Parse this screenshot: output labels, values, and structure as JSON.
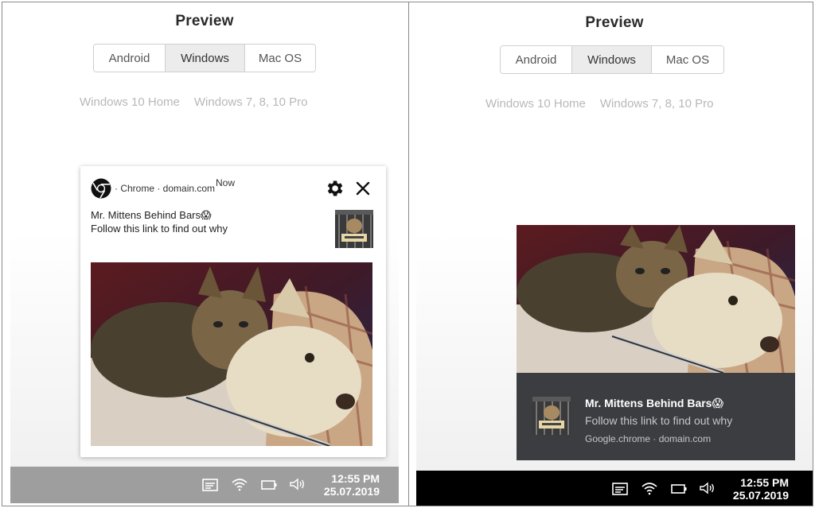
{
  "left": {
    "title": "Preview",
    "tabs": [
      {
        "label": "Android",
        "active": false
      },
      {
        "label": "Windows",
        "active": true
      },
      {
        "label": "Mac OS",
        "active": false
      }
    ],
    "sub_links": [
      "Windows 10 Home",
      "Windows 7, 8, 10 Pro"
    ],
    "notification": {
      "source": "· Chrome · domain.com",
      "time": "Now",
      "title": "Mr. Mittens Behind Bars😱",
      "body": "Follow this link to find out why"
    },
    "taskbar": {
      "time": "12:55 PM",
      "date": "25.07.2019",
      "bg": "#9e9e9e"
    }
  },
  "right": {
    "title": "Preview",
    "tabs": [
      {
        "label": "Android",
        "active": false
      },
      {
        "label": "Windows",
        "active": true
      },
      {
        "label": "Mac OS",
        "active": false
      }
    ],
    "sub_links": [
      "Windows 10 Home",
      "Windows 7, 8, 10 Pro"
    ],
    "notification": {
      "title": "Mr. Mittens Behind Bars😱",
      "body": "Follow this link to find out why",
      "source": "Google.chrome  ·  domain.com",
      "bg": "#3b3d40"
    },
    "taskbar": {
      "time": "12:55 PM",
      "date": "25.07.2019",
      "bg": "#000000"
    }
  },
  "icons": {
    "brand": "chrome-logo-icon",
    "settings": "gear-icon",
    "close": "close-icon",
    "tray": [
      "action-center-icon",
      "wifi-icon",
      "battery-icon",
      "volume-icon"
    ]
  }
}
